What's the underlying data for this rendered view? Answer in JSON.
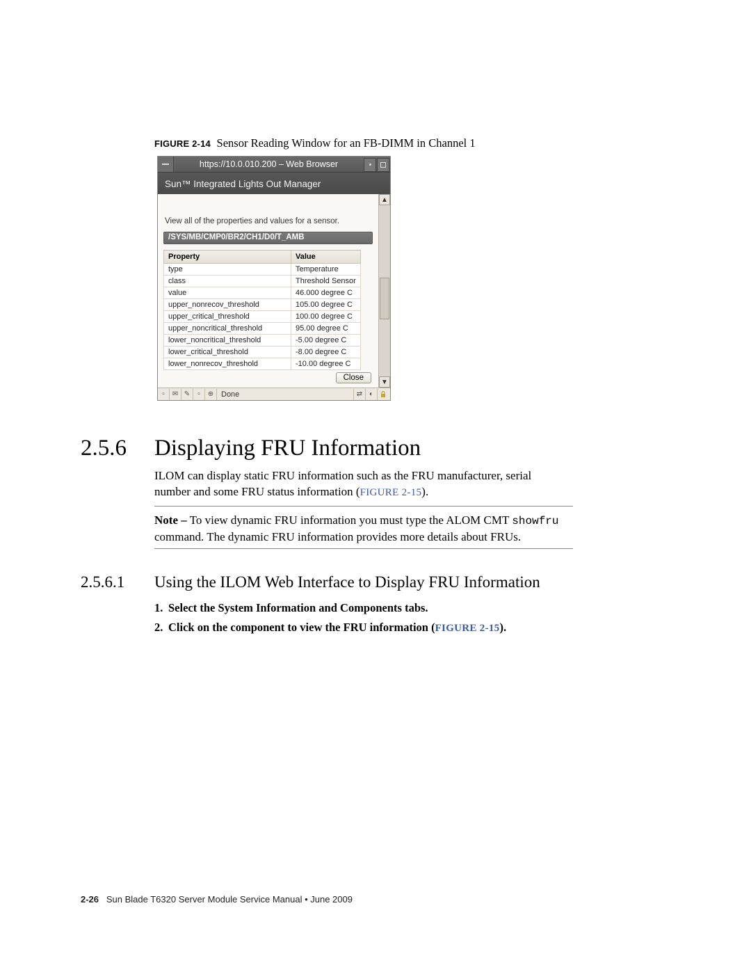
{
  "figure": {
    "label": "FIGURE 2-14",
    "caption": "Sensor Reading Window for an FB-DIMM in Channel 1"
  },
  "browser": {
    "title": "https://10.0.010.200 – Web Browser",
    "banner": "Sun™ Integrated Lights Out Manager",
    "hint": "View all of the properties and values for a sensor.",
    "path": "/SYS/MB/CMP0/BR2/CH1/D0/T_AMB",
    "col_property": "Property",
    "col_value": "Value",
    "rows": [
      {
        "p": "type",
        "v": "Temperature"
      },
      {
        "p": "class",
        "v": "Threshold Sensor"
      },
      {
        "p": "value",
        "v": "46.000 degree C"
      },
      {
        "p": "upper_nonrecov_threshold",
        "v": "105.00 degree C"
      },
      {
        "p": "upper_critical_threshold",
        "v": "100.00 degree C"
      },
      {
        "p": "upper_noncritical_threshold",
        "v": "95.00 degree C"
      },
      {
        "p": "lower_noncritical_threshold",
        "v": "-5.00 degree C"
      },
      {
        "p": "lower_critical_threshold",
        "v": "-8.00 degree C"
      },
      {
        "p": "lower_nonrecov_threshold",
        "v": "-10.00 degree C"
      }
    ],
    "close": "Close",
    "status": "Done"
  },
  "section": {
    "num": "2.5.6",
    "title": "Displaying FRU Information",
    "text_before_link": "ILOM can display static FRU information such as the FRU manufacturer, serial number and some FRU status information (",
    "link": "FIGURE 2-15",
    "text_after_link": ")."
  },
  "note": {
    "label": "Note –",
    "before_code": " To view dynamic FRU information you must type the ALOM CMT ",
    "code": "showfru",
    "after_code": " command. The dynamic FRU information provides more details about FRUs."
  },
  "subsection": {
    "num": "2.5.6.1",
    "title": "Using the ILOM Web Interface to Display FRU Information",
    "step1_num": "1.",
    "step1": "Select the System Information and Components tabs.",
    "step2_num": "2.",
    "step2_a": "Click on the component to view the FRU information (",
    "step2_link": "FIGURE 2-15",
    "step2_b": ")."
  },
  "footer": {
    "page": "2-26",
    "text": "Sun Blade T6320 Server Module Service Manual  •  June 2009"
  }
}
